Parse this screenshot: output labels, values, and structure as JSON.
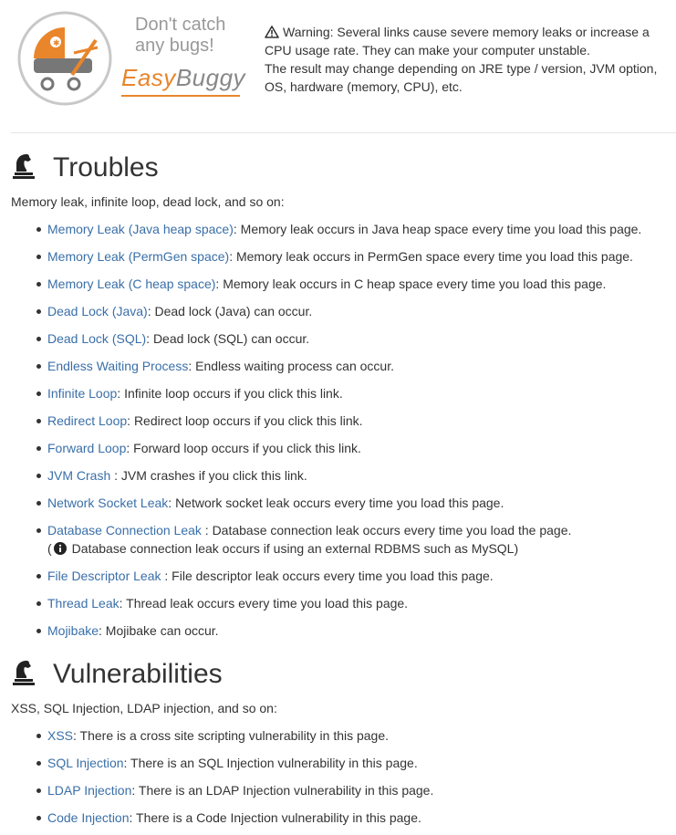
{
  "header": {
    "tagline": "Don't catch any bugs!",
    "brand": "EasyBuggy",
    "brand_part1": "Easy",
    "brand_part2": "Buggy",
    "warning_line1": "Warning: Several links cause severe memory leaks or increase a CPU usage rate. They can make your computer unstable.",
    "warning_line2": "The result may change depending on JRE type / version, JVM option, OS, hardware (memory, CPU), etc."
  },
  "colors": {
    "link": "#3a6fa8",
    "brand_orange": "#e9852b",
    "text": "#333333"
  },
  "troubles": {
    "title": "Troubles",
    "intro": "Memory leak, infinite loop, dead lock, and so on:",
    "items": [
      {
        "link": "Memory Leak (Java heap space)",
        "desc": ": Memory leak occurs in Java heap space every time you load this page."
      },
      {
        "link": "Memory Leak (PermGen space)",
        "desc": ": Memory leak occurs in PermGen space every time you load this page."
      },
      {
        "link": "Memory Leak (C heap space)",
        "desc": ": Memory leak occurs in C heap space every time you load this page."
      },
      {
        "link": "Dead Lock (Java)",
        "desc": ": Dead lock (Java) can occur."
      },
      {
        "link": "Dead Lock (SQL)",
        "desc": ": Dead lock (SQL) can occur."
      },
      {
        "link": "Endless Waiting Process",
        "desc": ": Endless waiting process can occur."
      },
      {
        "link": "Infinite Loop",
        "desc": ": Infinite loop occurs if you click this link."
      },
      {
        "link": "Redirect Loop",
        "desc": ": Redirect loop occurs if you click this link."
      },
      {
        "link": "Forward Loop",
        "desc": ": Forward loop occurs if you click this link."
      },
      {
        "link": "JVM Crash",
        "desc": " : JVM crashes if you click this link."
      },
      {
        "link": "Network Socket Leak",
        "desc": ": Network socket leak occurs every time you load this page."
      },
      {
        "link": "Database Connection Leak",
        "desc": " : Database connection leak occurs every time you load the page.",
        "note_open": "(",
        "note": "Database connection leak occurs if using an external RDBMS such as MySQL)"
      },
      {
        "link": "File Descriptor Leak",
        "desc": " : File descriptor leak occurs every time you load this page."
      },
      {
        "link": "Thread Leak",
        "desc": ": Thread leak occurs every time you load this page."
      },
      {
        "link": "Mojibake",
        "desc": ": Mojibake can occur."
      }
    ]
  },
  "vulnerabilities": {
    "title": "Vulnerabilities",
    "intro": "XSS, SQL Injection, LDAP injection, and so on:",
    "items": [
      {
        "link": "XSS",
        "desc": ": There is a cross site scripting vulnerability in this page."
      },
      {
        "link": "SQL Injection",
        "desc": ": There is an SQL Injection vulnerability in this page."
      },
      {
        "link": "LDAP Injection",
        "desc": ": There is an LDAP Injection vulnerability in this page."
      },
      {
        "link": "Code Injection",
        "desc": ": There is a Code Injection vulnerability in this page."
      }
    ]
  }
}
